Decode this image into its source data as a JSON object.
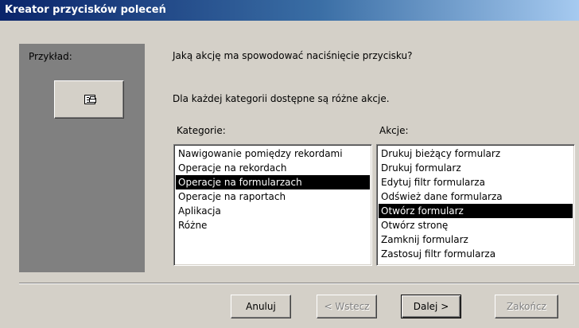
{
  "window": {
    "title": "Kreator przycisków poleceń"
  },
  "example": {
    "label": "Przykład:",
    "icon": "form-icon"
  },
  "question": "Jaką akcję ma spowodować naciśnięcie przycisku?",
  "info": "Dla każdej kategorii dostępne są różne akcje.",
  "categories": {
    "label": "Kategorie:",
    "items": [
      "Nawigowanie pomiędzy rekordami",
      "Operacje na rekordach",
      "Operacje na formularzach",
      "Operacje na raportach",
      "Aplikacja",
      "Różne"
    ],
    "selected_index": 2
  },
  "actions": {
    "label": "Akcje:",
    "items": [
      "Drukuj bieżący formularz",
      "Drukuj formularz",
      "Edytuj filtr formularza",
      "Odśwież dane formularza",
      "Otwórz formularz",
      "Otwórz stronę",
      "Zamknij formularz",
      "Zastosuj filtr formularza"
    ],
    "selected_index": 4
  },
  "buttons": {
    "cancel": "Anuluj",
    "back": "< Wstecz",
    "next": "Dalej >",
    "finish": "Zakończ"
  },
  "colors": {
    "title_start": "#0a246a",
    "title_end": "#a6caf0",
    "selection": "#000000",
    "dialog_bg": "#d4d0c8"
  }
}
